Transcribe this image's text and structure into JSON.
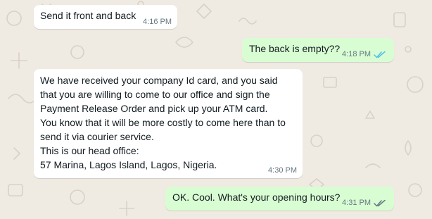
{
  "colors": {
    "background": "#efeae2",
    "incoming_bubble": "#ffffff",
    "outgoing_bubble": "#d9fdd3",
    "text": "#111b21",
    "meta": "#667781",
    "read_tick": "#53bdeb",
    "delivered_tick": "#667781"
  },
  "messages": [
    {
      "direction": "incoming",
      "text": "Send it front and back",
      "time": "4:16 PM"
    },
    {
      "direction": "outgoing",
      "text": "The back is empty??",
      "time": "4:18 PM",
      "status_icon": "double-check-read-icon"
    },
    {
      "direction": "incoming",
      "lines": [
        "We have received your company Id card, and you said",
        "that you are willing to come to our office and sign the",
        "Payment Release Order and pick up your ATM card.",
        "You know that it will be more costly to come here than to",
        "send it via courier service.",
        "This is our head office:",
        "57 Marina, Lagos Island, Lagos, Nigeria."
      ],
      "time": "4:30 PM"
    },
    {
      "direction": "outgoing",
      "text": "OK. Cool. What's your opening hours?",
      "time": "4:31 PM",
      "status_icon": "double-check-delivered-icon"
    }
  ]
}
